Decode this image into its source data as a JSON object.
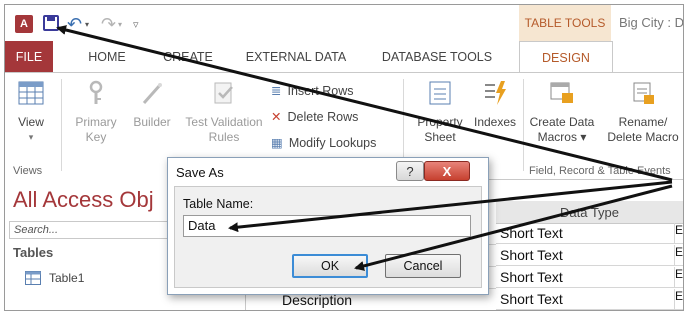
{
  "titlebar": {
    "context_title": "TABLE TOOLS",
    "app_title": "Big City : D"
  },
  "tabs": [
    "FILE",
    "HOME",
    "CREATE",
    "EXTERNAL DATA",
    "DATABASE TOOLS",
    "DESIGN"
  ],
  "ribbon": {
    "views_label": "Views",
    "view_btn": "View",
    "primary_key": [
      "Primary",
      "Key"
    ],
    "builder": "Builder",
    "test_validation": [
      "Test Validation",
      "Rules"
    ],
    "insert_rows": "Insert Rows",
    "delete_rows": "Delete Rows",
    "modify_lookups": "Modify Lookups",
    "property_sheet": [
      "Property",
      "Sheet"
    ],
    "indexes": "Indexes",
    "create_data_macros": [
      "Create Data",
      "Macros ▾"
    ],
    "rename_delete_macro": [
      "Rename/",
      "Delete Macro"
    ],
    "field_record_label": "Field, Record & Table Events",
    "show_hide_label": "e"
  },
  "nav": {
    "title": "All Access Obj",
    "search_placeholder": "Search...",
    "section": "Tables",
    "item": "Table1"
  },
  "grid": {
    "header": "Data Type",
    "rows": [
      "Short Text",
      "Short Text",
      "Short Text",
      "Short Text"
    ],
    "trailing": [
      "E",
      "E",
      "E",
      "E"
    ],
    "field_desc": "Description"
  },
  "dialog": {
    "title": "Save As",
    "help": "?",
    "close": "X",
    "label": "Table Name:",
    "value": "Data",
    "ok": "OK",
    "cancel": "Cancel"
  },
  "colors": {
    "accent": "#a4373a",
    "context": "#b55a2a"
  }
}
